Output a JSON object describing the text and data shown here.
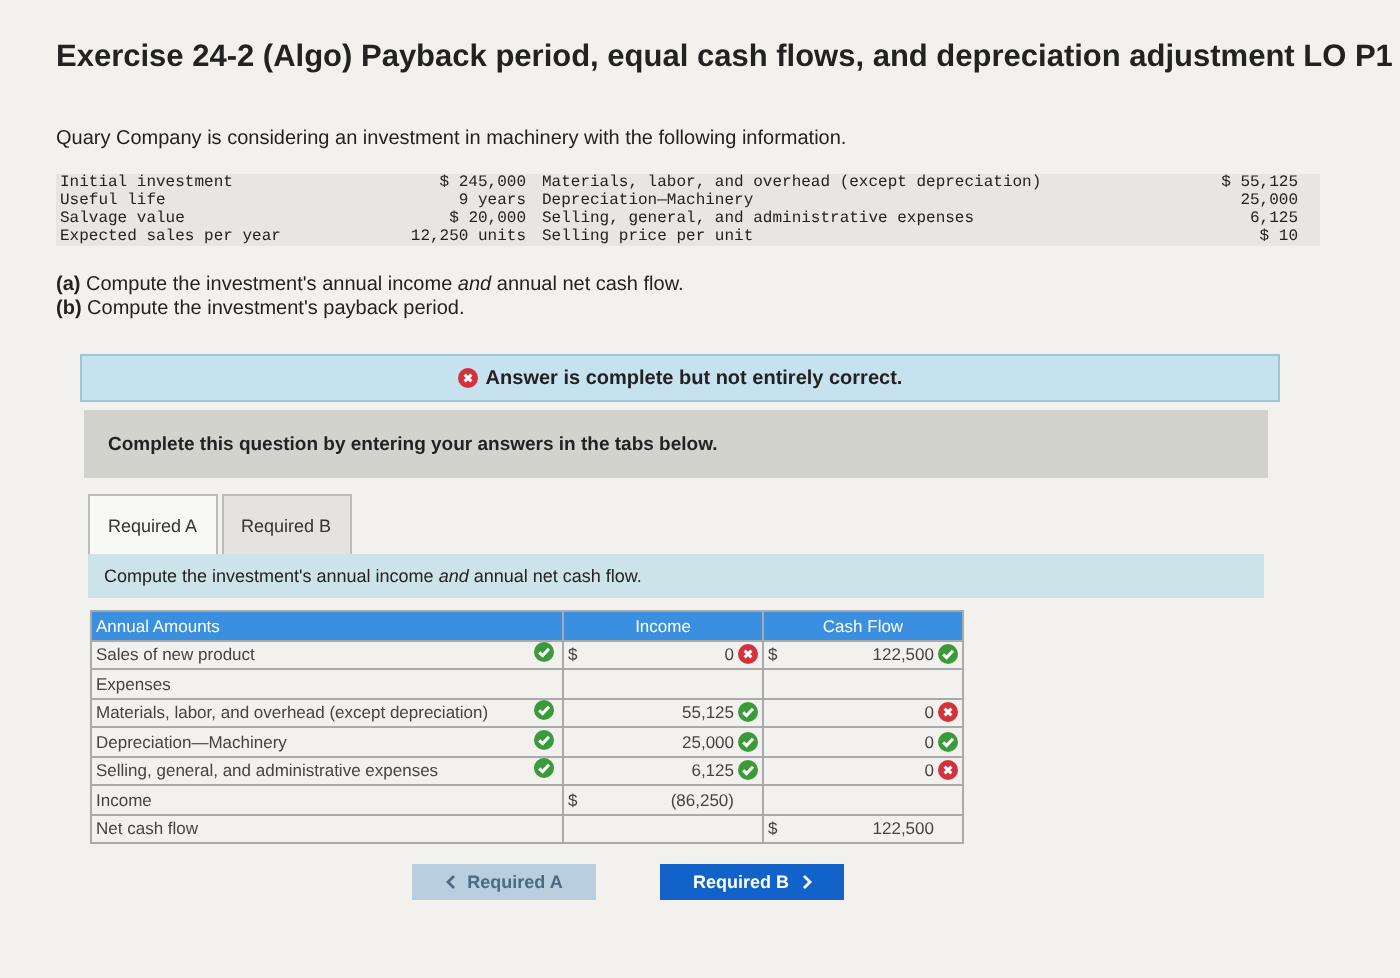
{
  "title": "Exercise 24-2 (Algo) Payback period, equal cash flows, and depreciation adjustment LO P1",
  "intro": "Quary Company is considering an investment in machinery with the following information.",
  "info_left": [
    {
      "label": "Initial investment",
      "value": "$ 245,000"
    },
    {
      "label": "Useful life",
      "value": "9 years"
    },
    {
      "label": "Salvage value",
      "value": "$ 20,000"
    },
    {
      "label": "Expected sales per year",
      "value": "12,250 units"
    }
  ],
  "info_right": [
    {
      "label": "Materials, labor, and overhead (except depreciation)",
      "value": "$ 55,125"
    },
    {
      "label": "Depreciation—Machinery",
      "value": "25,000"
    },
    {
      "label": "Selling, general, and administrative expenses",
      "value": "6,125"
    },
    {
      "label": "Selling price per unit",
      "value": "$ 10"
    }
  ],
  "questions": [
    "**(a)** Compute the investment's annual income *and* annual net cash flow.",
    "**(b)** Compute the investment's payback period."
  ],
  "result_banner": {
    "text": "Answer is complete but not entirely correct.",
    "correct": false
  },
  "instruction": "Complete this question by entering your answers in the tabs below.",
  "tabs": [
    {
      "label": "Required A",
      "selected": true
    },
    {
      "label": "Required B",
      "selected": false
    }
  ],
  "prompt": "Compute the investment's annual income *and* annual net cash flow.",
  "table": {
    "columns": [
      "Annual Amounts",
      "Income",
      "Cash Flow"
    ],
    "rows": [
      {
        "label": "Sales of new product",
        "label_correct": true,
        "income_prefix": "$",
        "income": "0",
        "income_correct": false,
        "cash_prefix": "$",
        "cash": "122,500",
        "cash_correct": true
      },
      {
        "label": "Expenses"
      },
      {
        "label": "Materials, labor, and overhead (except depreciation)",
        "label_correct": true,
        "income": "55,125",
        "income_correct": true,
        "cash": "0",
        "cash_correct": false
      },
      {
        "label": "Depreciation—Machinery",
        "label_correct": true,
        "income": "25,000",
        "income_correct": true,
        "cash": "0",
        "cash_correct": true
      },
      {
        "label": "Selling, general, and administrative expenses",
        "label_correct": true,
        "income": "6,125",
        "income_correct": true,
        "cash": "0",
        "cash_correct": false
      },
      {
        "label": "Income",
        "income_prefix": "$",
        "income": "(86,250)"
      },
      {
        "label": "Net cash flow",
        "cash_prefix": "$",
        "cash": "122,500"
      }
    ]
  },
  "nav": [
    {
      "label": "Required A",
      "disabled": true
    },
    {
      "label": "Required B",
      "disabled": false
    }
  ]
}
